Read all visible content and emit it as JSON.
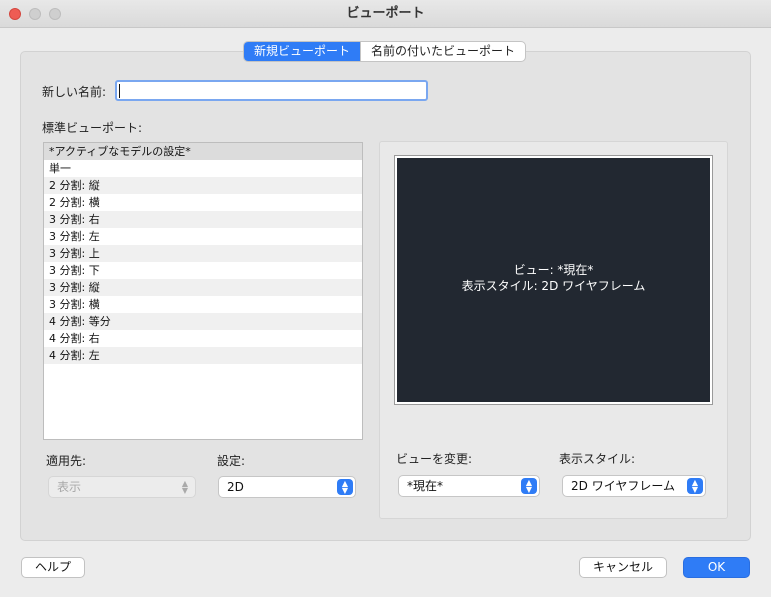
{
  "window": {
    "title": "ビューポート"
  },
  "tabs": [
    "新規ビューポート",
    "名前の付いたビューポート"
  ],
  "new_name": {
    "label": "新しい名前:",
    "value": ""
  },
  "standard_viewports": {
    "label": "標準ビューポート:",
    "items": [
      "*アクティブなモデルの設定*",
      "単一",
      "2 分割: 縦",
      "2 分割: 横",
      "3 分割: 右",
      "3 分割: 左",
      "3 分割: 上",
      "3 分割: 下",
      "3 分割: 縦",
      "3 分割: 横",
      "4 分割: 等分",
      "4 分割: 右",
      "4 分割: 左"
    ],
    "selected_index": 0
  },
  "preview": {
    "view_line": "ビュー: *現在*",
    "style_line": "表示スタイル: 2D ワイヤフレーム"
  },
  "apply_to": {
    "label": "適用先:",
    "value": "表示",
    "disabled": true
  },
  "setup": {
    "label": "設定:",
    "value": "2D"
  },
  "change_view": {
    "label": "ビューを変更:",
    "value": "*現在*"
  },
  "visual_style": {
    "label": "表示スタイル:",
    "value": "2D ワイヤフレーム"
  },
  "buttons": {
    "help": "ヘルプ",
    "cancel": "キャンセル",
    "ok": "OK"
  },
  "colors": {
    "accent": "#2f7cf6",
    "preview_bg": "#222831",
    "close": "#ee5c54"
  }
}
